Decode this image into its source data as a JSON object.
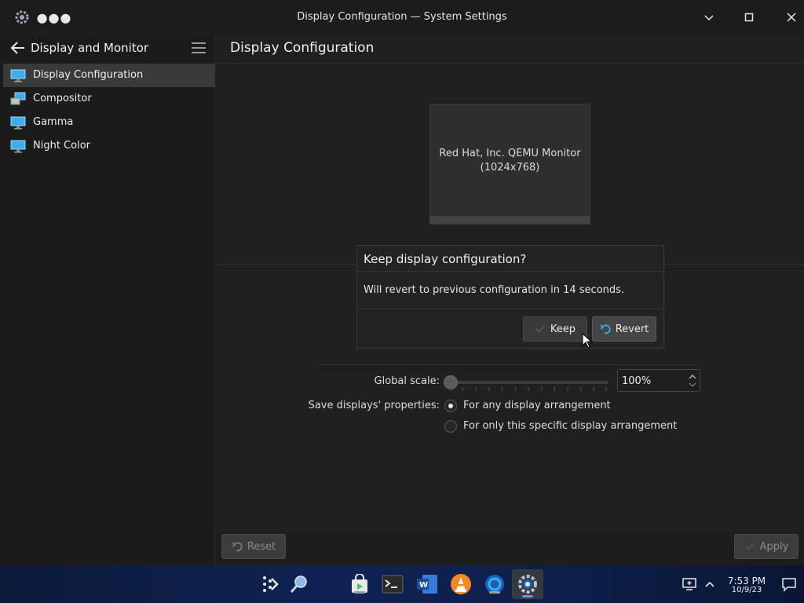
{
  "window": {
    "title": "Display Configuration — System Settings"
  },
  "sidebar": {
    "header": "Display and Monitor",
    "items": [
      {
        "label": "Display Configuration",
        "active": true
      },
      {
        "label": "Compositor"
      },
      {
        "label": "Gamma"
      },
      {
        "label": "Night Color"
      }
    ]
  },
  "main": {
    "title": "Display Configuration",
    "monitor": {
      "name": "Red Hat, Inc. QEMU Monitor",
      "resolution": "(1024x768)"
    }
  },
  "dialog": {
    "title": "Keep display configuration?",
    "message": "Will revert to previous configuration in 14 seconds.",
    "keep_label": "Keep",
    "revert_label": "Revert"
  },
  "settings": {
    "scale_label": "Global scale:",
    "scale_value": "100%",
    "save_label": "Save displays' properties:",
    "radio_options": [
      {
        "label": "For any display arrangement",
        "selected": true
      },
      {
        "label": "For only this specific display arrangement",
        "selected": false
      }
    ]
  },
  "footer": {
    "reset_label": "Reset",
    "apply_label": "Apply"
  },
  "taskbar": {
    "time": "7:53 PM",
    "date": "10/9/23"
  },
  "colors": {
    "accent": "#3daee9",
    "window_bg": "#202020",
    "sidebar_active": "#3a3a3a"
  }
}
